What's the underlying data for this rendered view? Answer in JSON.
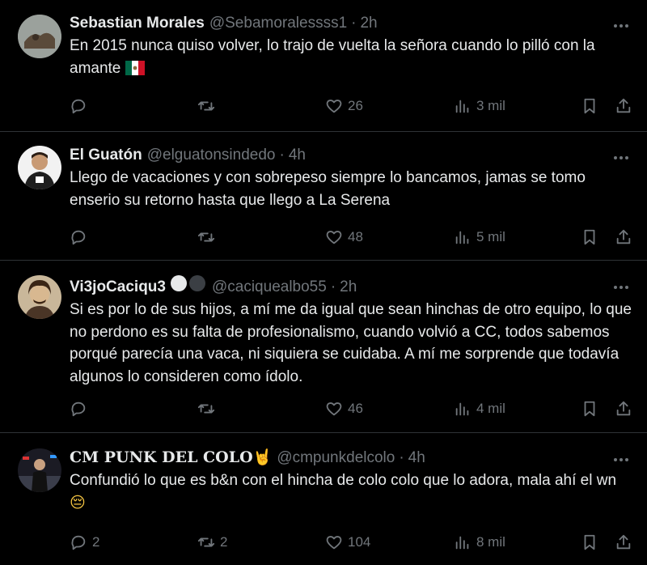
{
  "tweets": [
    {
      "name": "Sebastian Morales",
      "handle": "@Sebamoralessss1",
      "sep": "·",
      "time": "2h",
      "text": "En 2015 nunca quiso volver, lo trajo de vuelta la señora cuando lo pilló con la amante",
      "emoji": "mexico-flag",
      "reply": "",
      "retweet": "",
      "likes": "26",
      "views": "3 mil"
    },
    {
      "name": "El Guatón",
      "handle": "@elguatonsindedo",
      "sep": "·",
      "time": "4h",
      "text": "Llego de vacaciones y con sobrepeso siempre lo bancamos, jamas se tomo enserio su retorno hasta que llego a La Serena",
      "reply": "",
      "retweet": "",
      "likes": "48",
      "views": "5 mil"
    },
    {
      "name": "Vi3joCaciqu3",
      "handle": "@caciquealbo55",
      "sep": "·",
      "time": "2h",
      "text": "Si es por lo de sus hijos, a mí me da igual que sean hinchas de otro equipo, lo que no perdono es su falta de profesionalismo, cuando volvió a CC, todos sabemos porqué parecía una vaca, ni siquiera se cuidaba. A mí me sorprende que todavía algunos lo consideren como ídolo.",
      "badges": [
        "white-circle",
        "black-circle"
      ],
      "reply": "",
      "retweet": "",
      "likes": "46",
      "views": "4 mil"
    },
    {
      "name": "CM PUNK DEL COLO",
      "name_emoji": "🤘",
      "handle": "@cmpunkdelcolo",
      "sep": "·",
      "time": "4h",
      "text": "Confundió lo que es b&n con el hincha de colo colo que lo adora, mala ahí el wn",
      "emoji": "😔",
      "reply": "2",
      "retweet": "2",
      "likes": "104",
      "views": "8 mil"
    }
  ],
  "colors": {
    "background": "#000000",
    "text": "#e7e9ea",
    "muted": "#71767b",
    "divider": "#2f3336"
  }
}
